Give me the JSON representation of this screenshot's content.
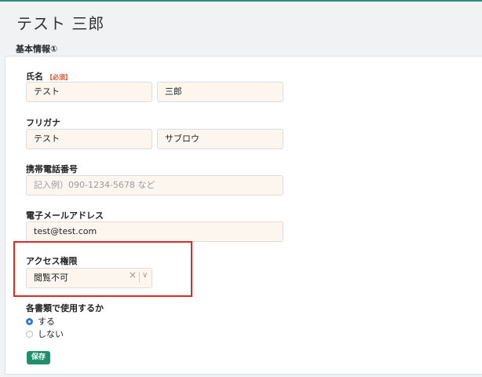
{
  "page": {
    "title": "テスト 三郎"
  },
  "section": {
    "title": "基本情報①"
  },
  "form": {
    "name": {
      "label": "氏名",
      "required": "【必須】",
      "last": "テスト",
      "first": "三郎"
    },
    "kana": {
      "label": "フリガナ",
      "last": "テスト",
      "first": "サブロウ"
    },
    "phone": {
      "label": "携帯電話番号",
      "placeholder": "記入例）090-1234-5678 など"
    },
    "email": {
      "label": "電子メールアドレス",
      "value": "test@test.com"
    },
    "access": {
      "label": "アクセス権限",
      "value": "閲覧不可",
      "clear_icon": "×",
      "arrow_icon": "∨"
    },
    "usage": {
      "label": "各書類で使用するか",
      "options": [
        "する",
        "しない"
      ],
      "selected": "する"
    }
  },
  "buttons": {
    "save": "保存"
  },
  "colors": {
    "accent": "#1f8f6c",
    "highlight": "#e02727",
    "required": "#e0542b",
    "radio": "#2f78d6"
  }
}
